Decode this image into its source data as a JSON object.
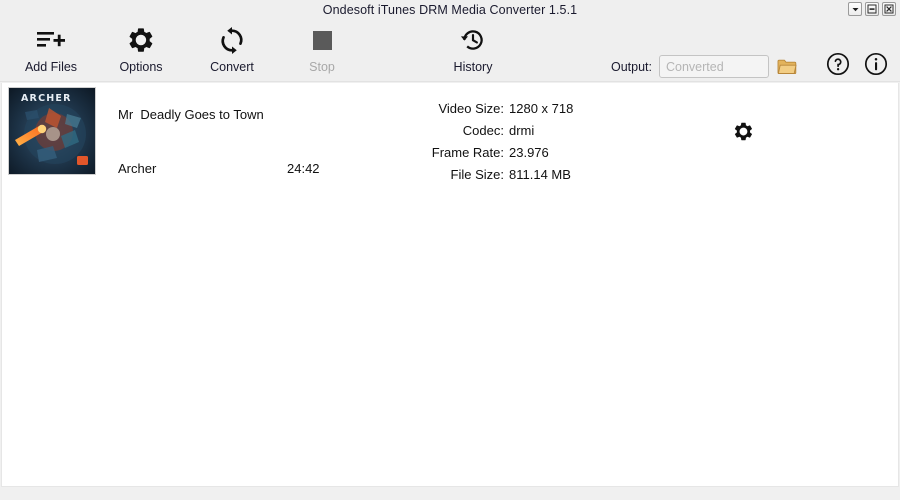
{
  "window": {
    "title": "Ondesoft iTunes DRM Media Converter 1.5.1",
    "controls": [
      {
        "name": "menu-dropdown",
        "glyph": "chevron-down-icon"
      },
      {
        "name": "minimize",
        "glyph": "minimize-icon"
      },
      {
        "name": "close",
        "glyph": "close-icon"
      }
    ]
  },
  "toolbar": {
    "add_files_label": "Add Files",
    "options_label": "Options",
    "convert_label": "Convert",
    "stop_label": "Stop",
    "history_label": "History",
    "stop_enabled": false,
    "output_label": "Output:",
    "output_value": "",
    "output_placeholder": "Converted",
    "folder_icon": "folder-icon",
    "help_icon": "help-circle-icon",
    "info_icon": "info-circle-icon",
    "add_files_icon": "list-plus-icon",
    "options_icon": "gear-icon",
    "convert_icon": "refresh-circular-icon",
    "stop_icon": "stop-square-icon",
    "history_icon": "clock-rewind-icon"
  },
  "list": {
    "items": [
      {
        "title": "Mr  Deadly Goes to Town",
        "artist": "Archer",
        "duration": "24:42",
        "artwork_label": "ARCHER",
        "settings_icon": "gear-icon",
        "metadata": [
          {
            "key": "Video Size:",
            "value": "1280 x 718"
          },
          {
            "key": "Codec:",
            "value": "drmi"
          },
          {
            "key": "Frame Rate:",
            "value": "23.976"
          },
          {
            "key": "File Size:",
            "value": "811.14 MB"
          }
        ]
      }
    ]
  },
  "colors": {
    "chrome": "#efefef",
    "content": "#ffffff",
    "text": "#1a1a2e",
    "disabled_text": "#a8a8a8",
    "stop_square": "#5a5a5a",
    "folder_accent": "#d9a441",
    "placeholder": "#b5b5b5"
  }
}
